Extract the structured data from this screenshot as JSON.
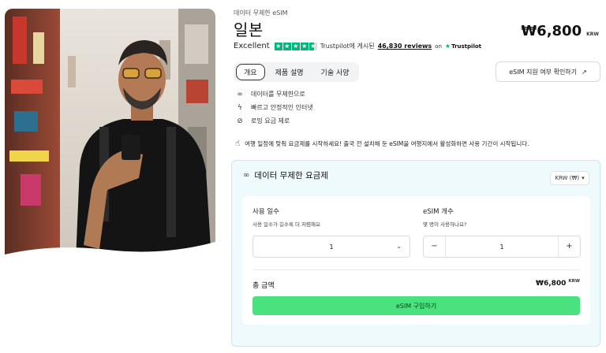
{
  "breadcrumb": "데이터 무제한 eSIM",
  "title": "일본",
  "price": {
    "amount": "₩6,800",
    "currency": "KRW"
  },
  "rating": {
    "label": "Excellent",
    "trustpilot_text": "Trustpilot에 게시된",
    "reviews": "46,830 reviews",
    "on": "on",
    "brand": "Trustpilot"
  },
  "tabs": [
    {
      "label": "개요",
      "active": true
    },
    {
      "label": "제품 설명",
      "active": false
    },
    {
      "label": "기술 사양",
      "active": false
    }
  ],
  "check_button": {
    "label": "eSIM 지원 여부 확인하기",
    "icon": "external-link-icon"
  },
  "features": [
    {
      "icon": "infinity-icon",
      "text": "데이터를 무제한으로"
    },
    {
      "icon": "bolt-icon",
      "text": "빠르고 안정적인 인터넷"
    },
    {
      "icon": "no-roaming-icon",
      "text": "로밍 요금 제로"
    }
  ],
  "notice": {
    "icon": "phone-hand-icon",
    "text": "여행 일정에 맞춰 요금제를 시작하세요! 출국 전 설치해 둔 eSIM을 여행지에서 활성화하면 사용 기간이 시작됩니다."
  },
  "plan": {
    "title": "데이터 무제한 요금제",
    "currency_select": "KRW (₩)",
    "days": {
      "label": "사용 일수",
      "help": "사용 일수가 길수록 더 저렴해요",
      "value": "1"
    },
    "esim_count": {
      "label": "eSIM 개수",
      "help": "몇 명이 사용하나요?",
      "value": "1",
      "minus": "−",
      "plus": "+"
    },
    "total": {
      "label": "총 금액",
      "amount": "₩6,800",
      "currency": "KRW"
    },
    "buy_label": "eSIM 구입하기"
  },
  "colors": {
    "accent_green": "#4ae17f",
    "trustpilot_green": "#00b67a",
    "plan_bg": "#eefafb"
  }
}
